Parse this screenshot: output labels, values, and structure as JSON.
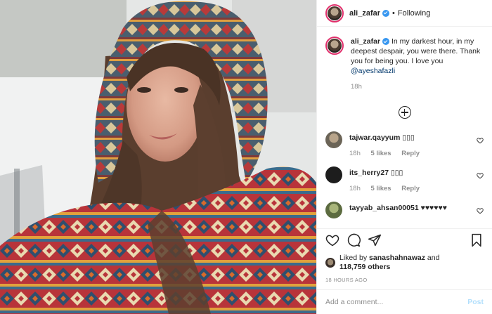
{
  "post": {
    "author": "ali_zafar",
    "follow_state": "Following",
    "dot": "•",
    "caption": {
      "author": "ali_zafar",
      "text": " In my darkest hour, in my deepest despair, you were there. Thank you for being you. I love you ",
      "mention": "@ayeshafazli",
      "time": "18h"
    },
    "comments": [
      {
        "user": "tajwar.qayyum",
        "text": "▯▯▯",
        "time": "18h",
        "likes": "5 likes",
        "reply": "Reply",
        "avatar_color": "#6b6457"
      },
      {
        "user": "its_herry27",
        "text": "▯▯▯",
        "time": "18h",
        "likes": "5 likes",
        "reply": "Reply",
        "avatar_color": "#1d1d1d"
      },
      {
        "user": "tayyab_ahsan00051",
        "text": "♥♥♥♥♥♥",
        "time": "",
        "likes": "",
        "reply": "",
        "avatar_color": "#7b8c5a"
      }
    ],
    "liked_by": {
      "prefix": "Liked by ",
      "user": "sanashahnawaz",
      "and": " and",
      "others": "118,759 others"
    },
    "timestamp": "18 HOURS AGO",
    "add_comment_placeholder": "Add a comment...",
    "post_label": "Post"
  },
  "icons": {
    "like": "heart-icon",
    "comment": "comment-icon",
    "share": "share-icon",
    "save": "bookmark-icon",
    "load_more": "plus-circle-icon"
  },
  "colors": {
    "verified": "#3897f0",
    "story_ring": "#e1306c",
    "mention": "#00376b",
    "post_button": "#b2dffc"
  }
}
